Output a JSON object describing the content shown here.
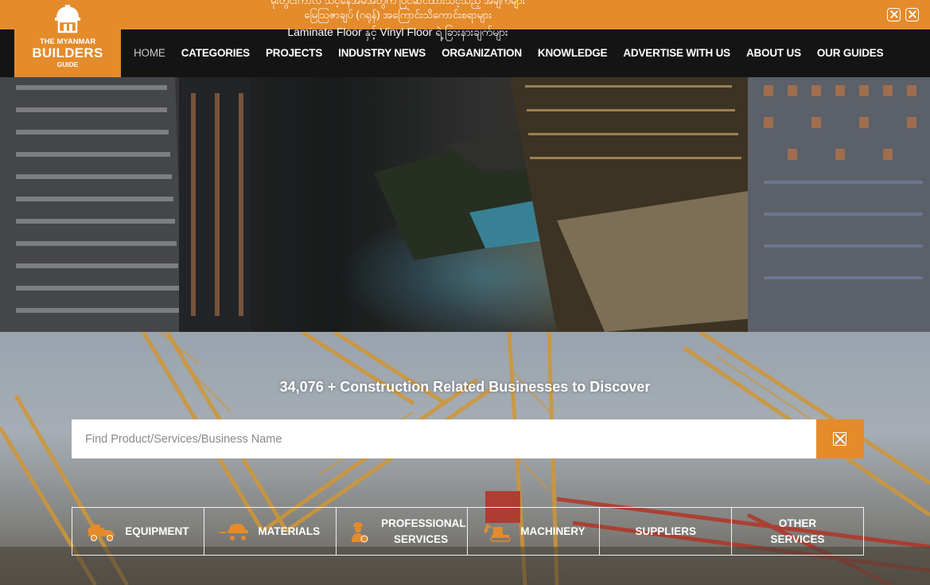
{
  "ticker": {
    "lines": [
      "မိုးတွင်းကာလ သင့်နေအိမ်အတွက် ပြင်ဆင်ထားသင့်သည့် အချက်များ",
      "မြေဩဇာချပ် (ဂရုန်) အကြောင်းသိကောင်းစရာများ",
      "Laminate Floor နှင့် Vinyl Floor ရဲ့ ခြားနားချက်များ"
    ]
  },
  "logo": {
    "line1": "THE MYANMAR",
    "line2": "BUILDERS",
    "line3": "GUIDE"
  },
  "nav": {
    "items": [
      "HOME",
      "CATEGORIES",
      "PROJECTS",
      "INDUSTRY NEWS",
      "ORGANIZATION",
      "KNOWLEDGE",
      "ADVERTISE WITH US",
      "ABOUT US",
      "OUR GUIDES"
    ]
  },
  "hero": {
    "headline": "34,076 + Construction Related Businesses to Discover"
  },
  "search": {
    "placeholder": "Find Product/Services/Business Name"
  },
  "categories": [
    {
      "label": "EQUIPMENT",
      "icon": "truck-icon"
    },
    {
      "label": "MATERIALS",
      "icon": "materials-icon"
    },
    {
      "label": "PROFESSIONAL SERVICES",
      "icon": "worker-icon"
    },
    {
      "label": "MACHINERY",
      "icon": "excavator-icon"
    },
    {
      "label": "SUPPLIERS",
      "icon": ""
    },
    {
      "label": "OTHER SERVICES",
      "icon": ""
    }
  ],
  "colors": {
    "accent": "#e48b2b",
    "nav_bg": "#141414"
  }
}
